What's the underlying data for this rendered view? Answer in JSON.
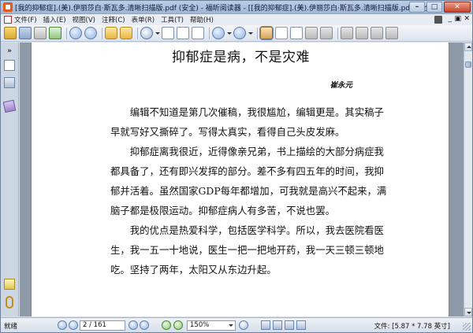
{
  "window": {
    "title": "[我的抑郁症].(美).伊丽莎白·斯瓦多.清晰扫描版.pdf (安全) - 福昕阅读器 - [[我的抑郁症].(美).伊丽莎白·斯瓦多.清晰扫描版.pdf (安全)]"
  },
  "menu": {
    "items": [
      "文件(F)",
      "插入(E)",
      "视图(V)",
      "注释(C)",
      "表单(R)",
      "工具(T)",
      "帮助(H)"
    ]
  },
  "toolbar": {
    "icons": [
      "open-icon",
      "save-icon",
      "print-icon",
      "email-icon",
      "first-page-icon",
      "last-page-icon",
      "back-arrow-icon",
      "forward-arrow-icon",
      "zoom-icon",
      "actual-size-icon",
      "fit-page-icon",
      "fit-width-icon",
      "zoom-out-icon",
      "zoom-in-icon",
      "hand-tool-icon",
      "select-text-icon",
      "snapshot-icon",
      "find-icon",
      "typewriter-icon",
      "highlight-icon",
      "note-icon",
      "pencil-icon",
      "stamp-icon"
    ]
  },
  "document": {
    "title": "抑郁症是病，不是灾难",
    "author": "崔永元",
    "lines": [
      "　　编辑不知道是第几次催稿，我很尴尬，编辑更是。其实稿子",
      "早就写好又撕碎了。写得太真实，看得自己头皮发麻。",
      "　　抑郁症离我很近，近得像亲兄弟，书上描绘的大部分病症我",
      "都具备了，还有即兴发挥的部分。差不多有四五年的时间，我抑",
      "郁并活着。虽然国家GDP每年都增加，可我就是高兴不起来，满",
      "脑子都是极限运动。抑郁症病人有多苦，不说也罢。",
      "　　我的优点是热爱科学，包括医学科学。所以，我去医院看医",
      "生，我一五一十地说，医生一把一把地开药，我一天三顿三顿地",
      "吃。坚持了两年，太阳又从东边升起。"
    ]
  },
  "status": {
    "ready": "就绪",
    "page": "2 / 161",
    "zoom": "150%",
    "file_size": "文件: [5.87 * 7.78 英寸]"
  }
}
